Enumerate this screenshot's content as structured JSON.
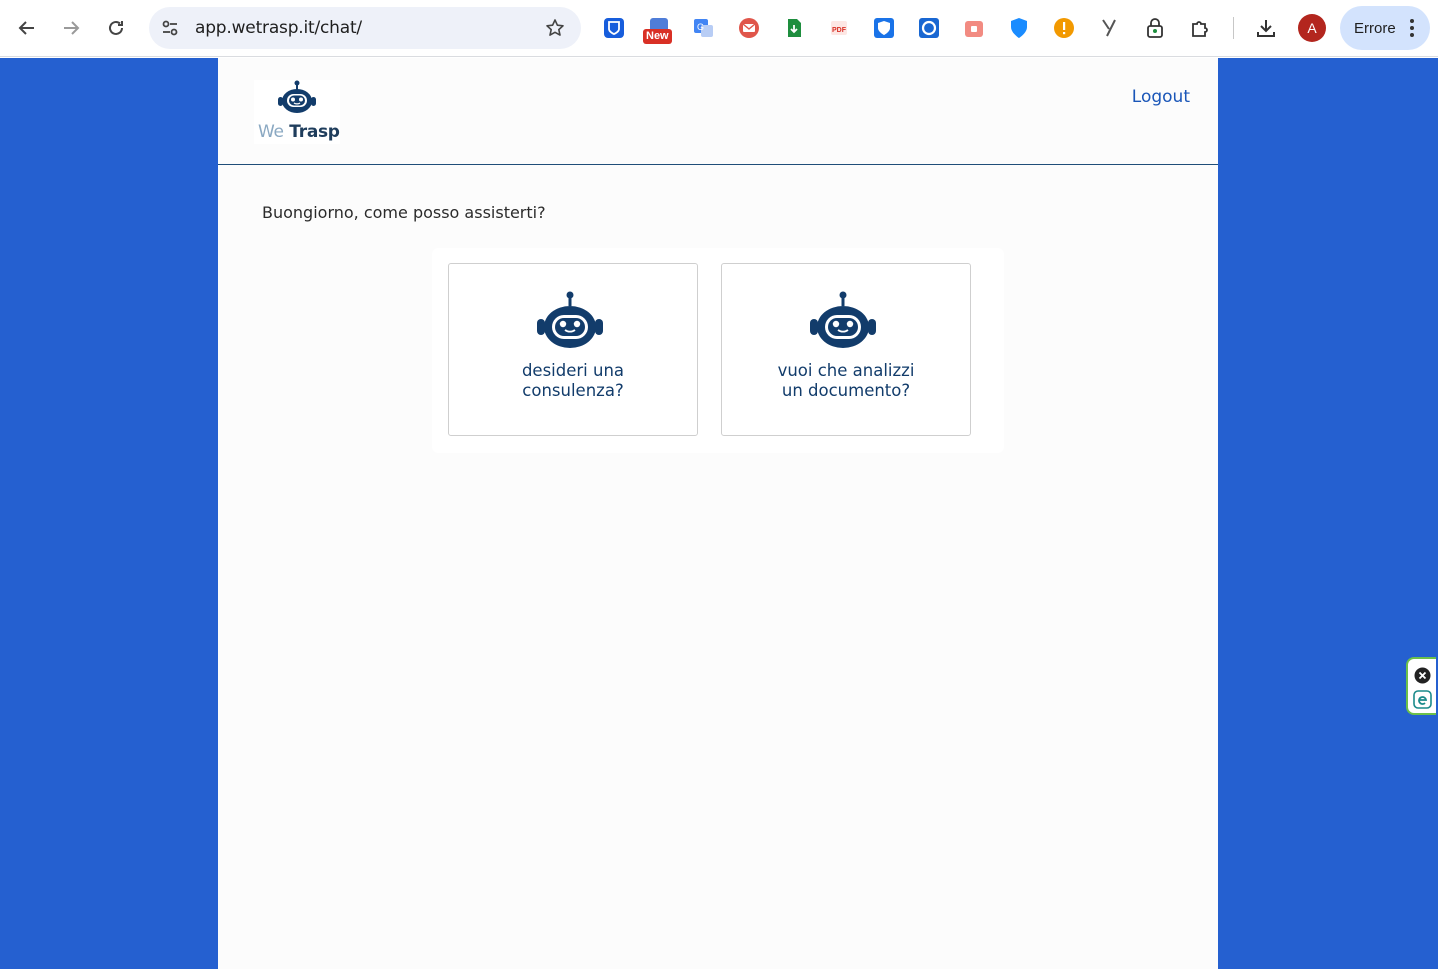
{
  "browser": {
    "url": "app.wetrasp.it/chat/",
    "extension_badge": "New",
    "profile_initial": "A",
    "error_label": "Errore",
    "extensions": [
      "bitwarden-icon",
      "new-extension-icon",
      "translate-icon",
      "mail-icon",
      "green-download-icon",
      "pdf-icon",
      "shield-icon",
      "circle-icon",
      "bag-icon",
      "blue-shield-icon",
      "warning-icon",
      "grammar-icon",
      "lock-icon",
      "puzzle-icon"
    ]
  },
  "app": {
    "logo": {
      "part1": "We",
      "part2": " Trasp"
    },
    "logout_label": "Logout",
    "greeting": "Buongiorno, come posso assisterti?",
    "options": [
      {
        "label": "desideri una\nconsulenza?"
      },
      {
        "label": "vuoi che analizzi\nun documento?"
      }
    ]
  },
  "colors": {
    "page_background": "#2560d0",
    "brand_dark_blue": "#123c6b",
    "link_blue": "#1a56b8"
  }
}
